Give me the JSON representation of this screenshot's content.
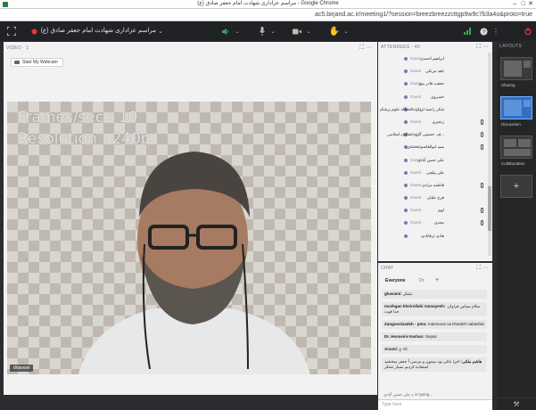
{
  "browser": {
    "title": "مراسم عزاداری شهادت امام جعفر صادق (ع) - Google Chrome",
    "url": "ac5.birjand.ac.ir/meeting1/?session=breezbreezzcttgp9w9c7b3a4o&proto=true"
  },
  "toolbar": {
    "meeting_title": "مراسم عزاداری شهادت امام جعفر صادق (ع)"
  },
  "video_pod": {
    "header": "VIDEO · 1",
    "start_webcam": "Start My Webcam",
    "overlay_line1": "Frames/sec : 10",
    "overlay_line2": "Resolution : 240p",
    "name_tag": "drlawsei"
  },
  "attendees": {
    "header": "ATTENDEES · 40",
    "rows": [
      {
        "name": "ابراهیم احمدی",
        "role": "Guest",
        "device": ""
      },
      {
        "name": "ناهد مرتکی",
        "role": "Guest",
        "device": ""
      },
      {
        "name": "جعفت قادر بنور",
        "role": "Guest",
        "device": ""
      },
      {
        "name": "خسروی",
        "role": "Guest",
        "device": ""
      },
      {
        "name": "شکر راضیه اوران دانشگاه علوم پزشکی بیرجند",
        "role": "Guest",
        "device": ""
      },
      {
        "name": "زنجیری",
        "role": "Guest",
        "device": "phone"
      },
      {
        "name": "...ف. حسینی گروه معارف اسلامی",
        "role": "Guest",
        "device": "mic"
      },
      {
        "name": "سید ابوالقاسم محمدی",
        "role": "Guest",
        "device": "phone"
      },
      {
        "name": "علی حسن آبادی",
        "role": "Guest",
        "device": ""
      },
      {
        "name": "علی بیلچی",
        "role": "Guest",
        "device": ""
      },
      {
        "name": "فاطمه مرادی",
        "role": "Guest",
        "device": "phone"
      },
      {
        "name": "فرح علیان",
        "role": "Guest",
        "device": ""
      },
      {
        "name": "لوی",
        "role": "Guest",
        "device": "phone"
      },
      {
        "name": "مجدی",
        "role": "Guest",
        "device": "phone"
      },
      {
        "name": "هادی ثرفابادی",
        "role": "",
        "device": ""
      }
    ]
  },
  "chat": {
    "header": "CHAT",
    "tabs": [
      "Everyone",
      "Dr.",
      "+"
    ],
    "messages": [
      {
        "sender": "ghavami:",
        "text": "تشکر"
      },
      {
        "sender": "mozhgan kheirollahi Azmayesh:",
        "text": "سلام سپاس فراوان. خدا قوت"
      },
      {
        "sender": "Zangooeizadeh - pmu:",
        "text": "mamnoon va khasteh nabashid"
      },
      {
        "sender": "Dr. Hosseini-Vashan:",
        "text": "Sepas"
      },
      {
        "sender": "Arzani:",
        "text": "ع Ali"
      },
      {
        "sender": "هاشم ملکی:",
        "text": "اجرا عالی بود ممنون و مرسی آ جعفر مبخشید استفاده کردیم بسیار تشکر"
      }
    ],
    "typing": "ه علی حسن آبادی is typing...",
    "input_placeholder": "Type here"
  },
  "layouts": {
    "header": "LAYOUTS",
    "items": [
      {
        "label": "Sharing",
        "selected": false
      },
      {
        "label": "Discussion",
        "selected": true
      },
      {
        "label": "Collaboration",
        "selected": false
      }
    ],
    "add_label": "+"
  }
}
